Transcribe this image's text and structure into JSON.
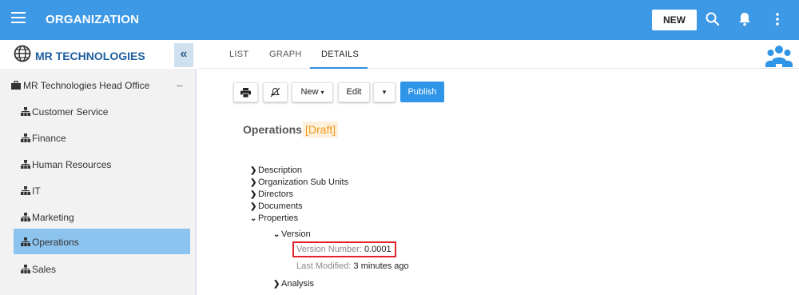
{
  "header": {
    "title": "ORGANIZATION",
    "new_label": "NEW",
    "brand_color": "#3d98e6",
    "icons": [
      "menu-icon",
      "search-icon",
      "bell-icon",
      "more-vertical-icon"
    ]
  },
  "sidebar": {
    "company": "MR TECHNOLOGIES",
    "collapse_label": "«",
    "head_office": "MR Technologies Head Office",
    "head_office_toggle": "–",
    "items": [
      {
        "label": "Customer Service"
      },
      {
        "label": "Finance"
      },
      {
        "label": "Human Resources"
      },
      {
        "label": "IT"
      },
      {
        "label": "Marketing"
      },
      {
        "label": "Operations",
        "selected": true
      },
      {
        "label": "Sales"
      }
    ]
  },
  "tabs": [
    {
      "label": "LIST"
    },
    {
      "label": "GRAPH"
    },
    {
      "label": "DETAILS",
      "active": true
    }
  ],
  "toolbar": {
    "print_icon": "print-icon",
    "unfollow_icon": "bell-off-icon",
    "new_label": "New",
    "edit_label": "Edit",
    "publish_label": "Publish"
  },
  "details": {
    "title": "Operations",
    "status": "[Draft]",
    "sections": {
      "description": "Description",
      "sub_units": "Organization Sub Units",
      "directors": "Directors",
      "documents": "Documents",
      "properties": "Properties",
      "version": "Version",
      "analysis": "Analysis"
    },
    "version_number_label": "Version Number:",
    "version_number_value": "0.0001",
    "last_modified_label": "Last Modified:",
    "last_modified_value": "3 minutes ago"
  }
}
